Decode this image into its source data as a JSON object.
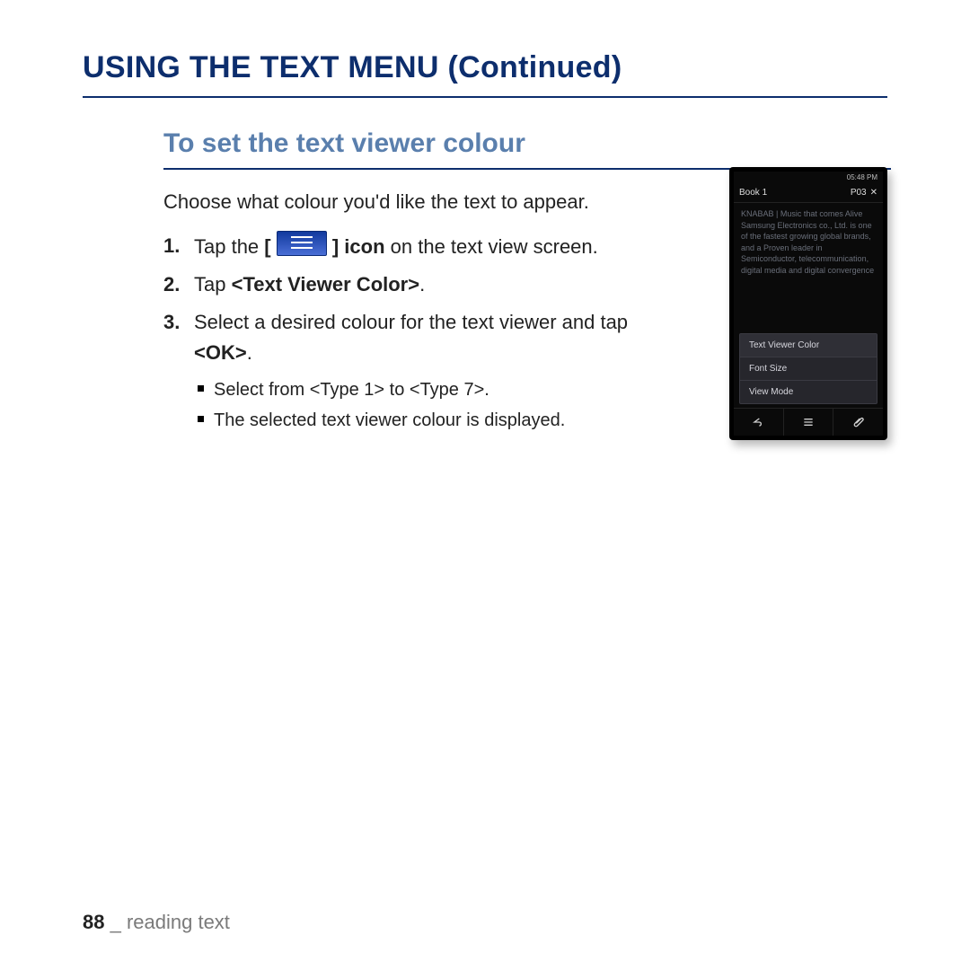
{
  "heading": "USING THE TEXT MENU (Continued)",
  "subheading": "To set the text viewer colour",
  "intro": "Choose what colour you'd like the text to appear.",
  "steps": {
    "s1": {
      "num": "1.",
      "a": "Tap the ",
      "bracket_open": "[ ",
      "bracket_close": " ] ",
      "b": "icon",
      "c": " on the text view screen."
    },
    "s2": {
      "num": "2.",
      "a": "Tap ",
      "b": "<Text Viewer Color>",
      "c": "."
    },
    "s3": {
      "num": "3.",
      "a": "Select a desired colour for the text viewer and tap ",
      "b": "<OK>",
      "c": "."
    }
  },
  "bullets": {
    "b1": "Select from <Type 1> to <Type 7>.",
    "b2": "The selected text viewer colour is displayed."
  },
  "screenshot": {
    "status_left": "",
    "status_right": "05:48 PM",
    "title": "Book 1",
    "page": "P03",
    "sample_text": "KNABAB | Music that comes Alive\nSamsung Electronics co., Ltd. is one of the fastest growing global brands,\nand a Proven leader in Semiconductor, telecommunication, digital media and digital convergence",
    "menu1": "Text Viewer Color",
    "menu2": "Font Size",
    "menu3": "View Mode"
  },
  "footer": {
    "page_no": "88",
    "sep": " _ ",
    "section": "reading text"
  }
}
